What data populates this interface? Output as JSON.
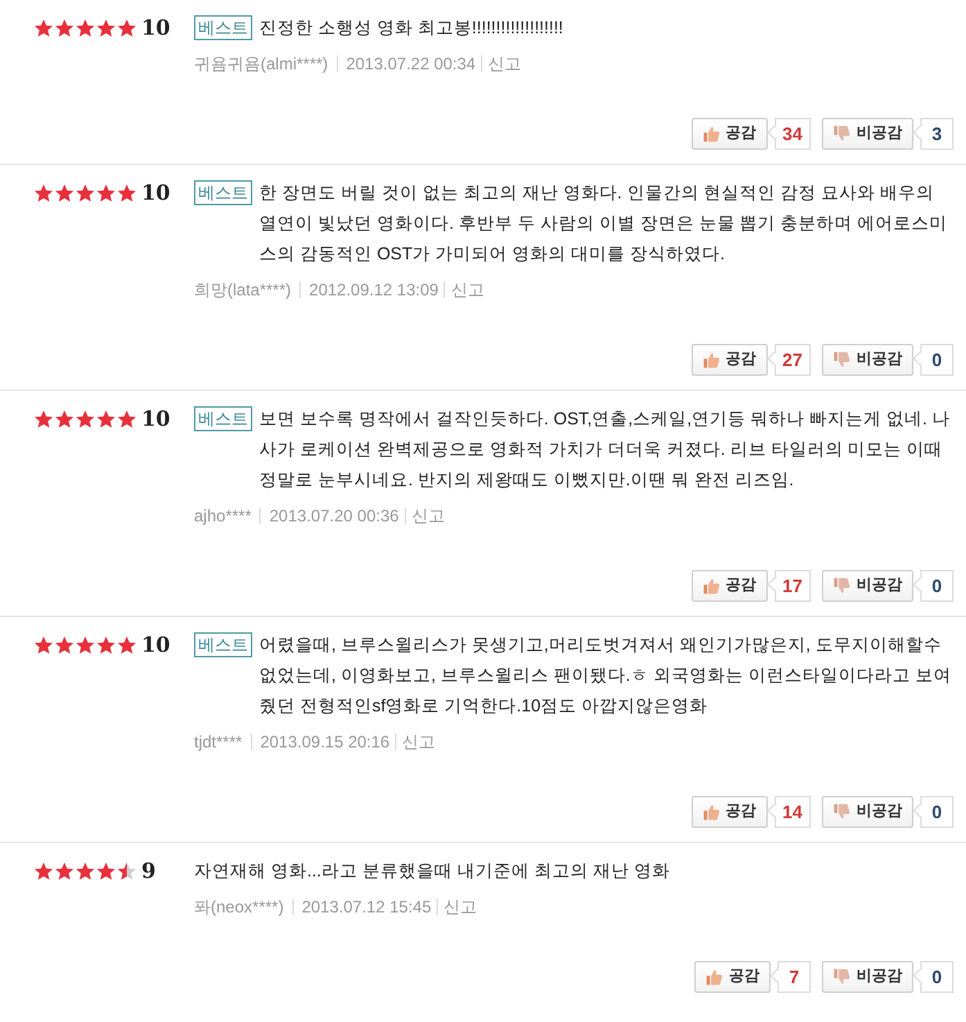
{
  "reviews": [
    {
      "stars": 5,
      "score": "10",
      "best": true,
      "best_label": "베스트",
      "text": "진정한 소행성 영화 최고봉!!!!!!!!!!!!!!!!!!!",
      "author": "귀욤귀욤(almi****)",
      "date": "2013.07.22 00:34",
      "report": "신고",
      "like_label": "공감",
      "likes": "34",
      "dislike_label": "비공감",
      "dislikes": "3"
    },
    {
      "stars": 5,
      "score": "10",
      "best": true,
      "best_label": "베스트",
      "text": "한 장면도 버릴 것이 없는 최고의 재난 영화다. 인물간의 현실적인 감정 묘사와 배우의 열연이 빛났던 영화이다. 후반부 두 사람의 이별 장면은 눈물 뽑기 충분하며 에어로스미스의 감동적인 OST가 가미되어 영화의 대미를 장식하였다.",
      "author": "희망(lata****)",
      "date": "2012.09.12 13:09",
      "report": "신고",
      "like_label": "공감",
      "likes": "27",
      "dislike_label": "비공감",
      "dislikes": "0"
    },
    {
      "stars": 5,
      "score": "10",
      "best": true,
      "best_label": "베스트",
      "text": "보면 보수록 명작에서 걸작인듯하다. OST,연출,스케일,연기등 뭐하나 빠지는게 없네. 나사가 로케이션 완벽제공으로 영화적 가치가 더더욱 커졌다. 리브 타일러의 미모는 이때 정말로 눈부시네요. 반지의 제왕때도 이뻤지만.이땐 뭐 완전 리즈임.",
      "author": "ajho****",
      "date": "2013.07.20 00:36",
      "report": "신고",
      "like_label": "공감",
      "likes": "17",
      "dislike_label": "비공감",
      "dislikes": "0"
    },
    {
      "stars": 5,
      "score": "10",
      "best": true,
      "best_label": "베스트",
      "text": "어렸을때, 브루스윌리스가 못생기고,머리도벗겨져서 왜인기가많은지, 도무지이해할수없었는데, 이영화보고, 브루스윌리스 팬이됐다.ㅎ 외국영화는 이런스타일이다라고 보여줬던 전형적인sf영화로 기억한다.10점도 아깝지않은영화",
      "author": "tjdt****",
      "date": "2013.09.15 20:16",
      "report": "신고",
      "like_label": "공감",
      "likes": "14",
      "dislike_label": "비공감",
      "dislikes": "0"
    },
    {
      "stars": 4.5,
      "score": "9",
      "best": false,
      "text": "자연재해 영화...라고 분류했을때 내기준에 최고의 재난 영화",
      "author": "퐈(neox****)",
      "date": "2013.07.12 15:45",
      "report": "신고",
      "like_label": "공감",
      "likes": "7",
      "dislike_label": "비공감",
      "dislikes": "0"
    }
  ]
}
